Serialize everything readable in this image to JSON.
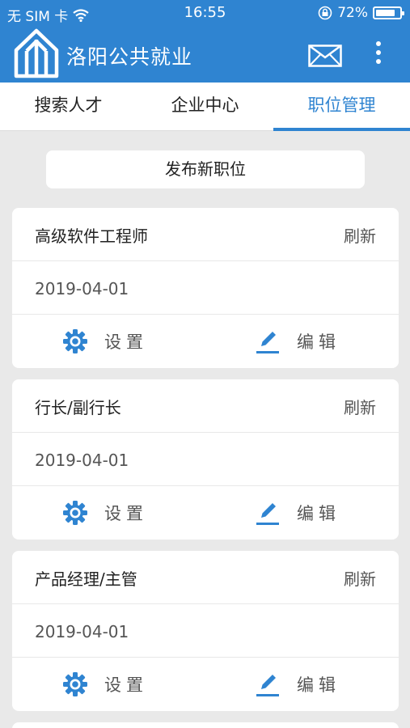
{
  "status_bar": {
    "carrier": "无 SIM 卡",
    "time": "16:55",
    "battery_percent": "72%",
    "battery_level": 0.72
  },
  "app_bar": {
    "title": "洛阳公共就业",
    "icons": [
      "logo-icon",
      "mail-icon",
      "more-vertical-icon"
    ]
  },
  "tabs": [
    {
      "label": "搜索人才",
      "active": false
    },
    {
      "label": "企业中心",
      "active": false
    },
    {
      "label": "职位管理",
      "active": true
    }
  ],
  "publish_button": "发布新职位",
  "jobs": [
    {
      "title": "高级软件工程师",
      "refresh": "刷新",
      "date": "2019-04-01",
      "settings": "设置",
      "edit": "编辑"
    },
    {
      "title": "行长/副行长",
      "refresh": "刷新",
      "date": "2019-04-01",
      "settings": "设置",
      "edit": "编辑"
    },
    {
      "title": "产品经理/主管",
      "refresh": "刷新",
      "date": "2019-04-01",
      "settings": "设置",
      "edit": "编辑"
    }
  ],
  "colors": {
    "primary": "#2f84d1",
    "background": "#e9e9e9",
    "card": "#ffffff",
    "text": "#222222",
    "muted_text": "#555555"
  }
}
